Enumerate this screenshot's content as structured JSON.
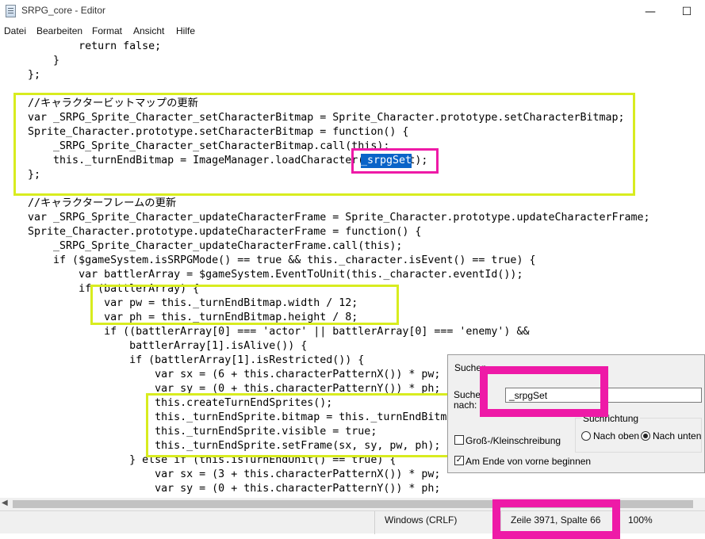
{
  "window": {
    "title": "SRPG_core - Editor",
    "minimize_glyph": "—",
    "maximize_glyph": "☐"
  },
  "menu": [
    "Datei",
    "Bearbeiten",
    "Format",
    "Ansicht",
    "Hilfe"
  ],
  "code_lines": [
    "            return false;",
    "        }",
    "    };",
    "",
    "    //キャラクタービットマップの更新",
    "    var _SRPG_Sprite_Character_setCharacterBitmap = Sprite_Character.prototype.setCharacterBitmap;",
    "    Sprite_Character.prototype.setCharacterBitmap = function() {",
    "        _SRPG_Sprite_Character_setCharacterBitmap.call(this);",
    "        this._turnEndBitmap = ImageManager.loadCharacter(_srpgSet);",
    "    };",
    "",
    "    //キャラクターフレームの更新",
    "    var _SRPG_Sprite_Character_updateCharacterFrame = Sprite_Character.prototype.updateCharacterFrame;",
    "    Sprite_Character.prototype.updateCharacterFrame = function() {",
    "        _SRPG_Sprite_Character_updateCharacterFrame.call(this);",
    "        if ($gameSystem.isSRPGMode() == true && this._character.isEvent() == true) {",
    "            var battlerArray = $gameSystem.EventToUnit(this._character.eventId());",
    "            if (battlerArray) {",
    "                var pw = this._turnEndBitmap.width / 12;",
    "                var ph = this._turnEndBitmap.height / 8;",
    "                if ((battlerArray[0] === 'actor' || battlerArray[0] === 'enemy') &&",
    "                    battlerArray[1].isAlive()) {",
    "                    if (battlerArray[1].isRestricted()) {",
    "                        var sx = (6 + this.characterPatternX()) * pw;",
    "                        var sy = (0 + this.characterPatternY()) * ph;",
    "                        this.createTurnEndSprites();",
    "                        this._turnEndSprite.bitmap = this._turnEndBitmap;",
    "                        this._turnEndSprite.visible = true;",
    "                        this._turnEndSprite.setFrame(sx, sy, pw, ph);",
    "                    } else if (this.isTurnEndUnit() == true) {",
    "                        var sx = (3 + this.characterPatternX()) * pw;",
    "                        var sy = (0 + this.characterPatternY()) * ph;"
  ],
  "selection": {
    "text": "_srpgSet"
  },
  "status": {
    "line_ending": "Windows (CRLF)",
    "position": "Zeile 3971, Spalte 66",
    "zoom": "100%"
  },
  "find_dialog": {
    "title": "Suchen",
    "search_label": "Suchen nach:",
    "search_value": "_srpgSet",
    "direction_label": "Suchrichtung",
    "up_label": "Nach oben",
    "down_label": "Nach unten",
    "case_label": "Groß-/Kleinschreibung",
    "wrap_label": "Am Ende von vorne beginnen",
    "case_checked": false,
    "wrap_checked": true,
    "direction_selected": "down"
  },
  "colors": {
    "highlight_yellow": "#d8ec1f",
    "highlight_magenta": "#ee1aa7",
    "selection_blue": "#0a64c8"
  }
}
